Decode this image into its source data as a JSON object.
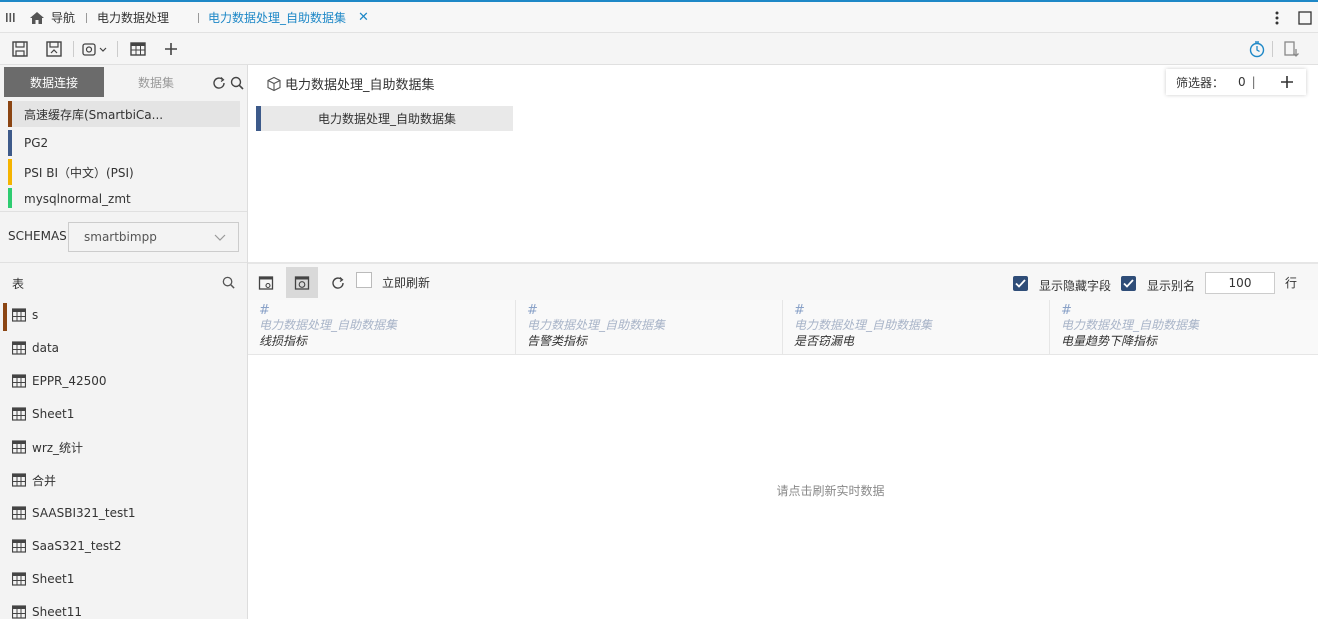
{
  "tabs": {
    "nav_label": "导航",
    "tab1_label": "电力数据处理",
    "tab2_label": "电力数据处理_自助数据集"
  },
  "left": {
    "seg_connection": "数据连接",
    "seg_dataset": "数据集",
    "connections": [
      {
        "label": "高速缓存库(SmartbiCa...",
        "color": "#8b4513"
      },
      {
        "label": "PG2",
        "color": "#3d5a8a"
      },
      {
        "label": "PSI BI（中文）(PSI)",
        "color": "#f5b400"
      },
      {
        "label": "mysqlnormal_zmt",
        "color": "#2ecc71"
      }
    ],
    "schemas_label": "SCHEMAS",
    "schema_value": "smartbimpp",
    "tables_label": "表",
    "tables": [
      "s",
      "data",
      "EPPR_42500",
      "Sheet1",
      "wrz_统计",
      "合并",
      "SAASBI321_test1",
      "SaaS321_test2",
      "Sheet1",
      "Sheet11"
    ]
  },
  "model": {
    "title": "电力数据处理_自助数据集",
    "filter_label": "筛选器：",
    "filter_count": "0",
    "node_label": "电力数据处理_自助数据集"
  },
  "preview": {
    "instant_refresh": "立即刷新",
    "show_hidden": "显示隐藏字段",
    "show_alias": "显示别名",
    "rows_value": "100",
    "rows_unit": "行",
    "empty_hint": "请点击刷新实时数据",
    "columns": [
      {
        "type": "#",
        "dataset": "电力数据处理_自助数据集",
        "field": "线损指标"
      },
      {
        "type": "#",
        "dataset": "电力数据处理_自助数据集",
        "field": "告警类指标"
      },
      {
        "type": "#",
        "dataset": "电力数据处理_自助数据集",
        "field": "是否窃漏电"
      },
      {
        "type": "#",
        "dataset": "电力数据处理_自助数据集",
        "field": "电量趋势下降指标"
      }
    ]
  },
  "colors": {
    "accent": "#1e88c7",
    "check": "#2f4d78"
  }
}
